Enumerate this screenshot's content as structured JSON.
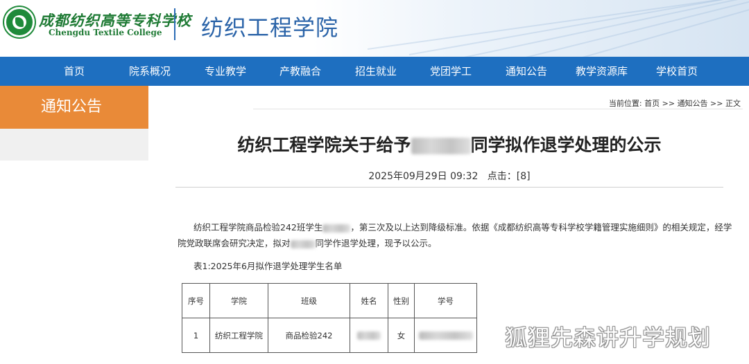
{
  "header": {
    "logo_cn": "成都纺织高等专科学校",
    "logo_en": "Chengdu Textile College",
    "site_name": "纺织工程学院"
  },
  "nav": {
    "items": [
      {
        "label": "首页"
      },
      {
        "label": "院系概况"
      },
      {
        "label": "专业教学"
      },
      {
        "label": "产教融合"
      },
      {
        "label": "招生就业"
      },
      {
        "label": "党团学工"
      },
      {
        "label": "通知公告"
      },
      {
        "label": "教学资源库"
      },
      {
        "label": "学校首页"
      }
    ]
  },
  "sidebar": {
    "title": "通知公告"
  },
  "breadcrumb": {
    "prefix": "当前位置: ",
    "items": [
      "首页",
      "通知公告",
      "正文"
    ],
    "separator": " >> "
  },
  "article": {
    "title_before": "纺织工程学院关于给予",
    "title_after": "同学拟作退学处理的公示",
    "date": "2025年09月29日 09:32",
    "clicks_label": "点击：",
    "clicks_value": "[8]",
    "p1_a": "纺织工程学院商品检验242班学生",
    "p1_b": "，第三次及以上达到降级标准。依据《成都纺织高等专科学校学籍管理实施细则》的相关规定，经学",
    "p2_a": "院党政联席会研究决定，拟对",
    "p2_b": "同学作退学处理，现予以公示。",
    "table_caption": "表1:2025年6月拟作退学处理学生名单"
  },
  "table": {
    "headers": [
      "序号",
      "学院",
      "班级",
      "姓名",
      "性别",
      "学号"
    ],
    "rows": [
      {
        "no": "1",
        "college": "纺织工程学院",
        "class": "商品检验242",
        "gender": "女"
      }
    ]
  },
  "watermark": {
    "text": "狐狸先森讲升学规划"
  },
  "colors": {
    "nav_bg": "#1e6fc0",
    "sidebar_accent": "#e98a38",
    "logo_green": "#1e7a34",
    "site_name_blue": "#2a63a8"
  }
}
